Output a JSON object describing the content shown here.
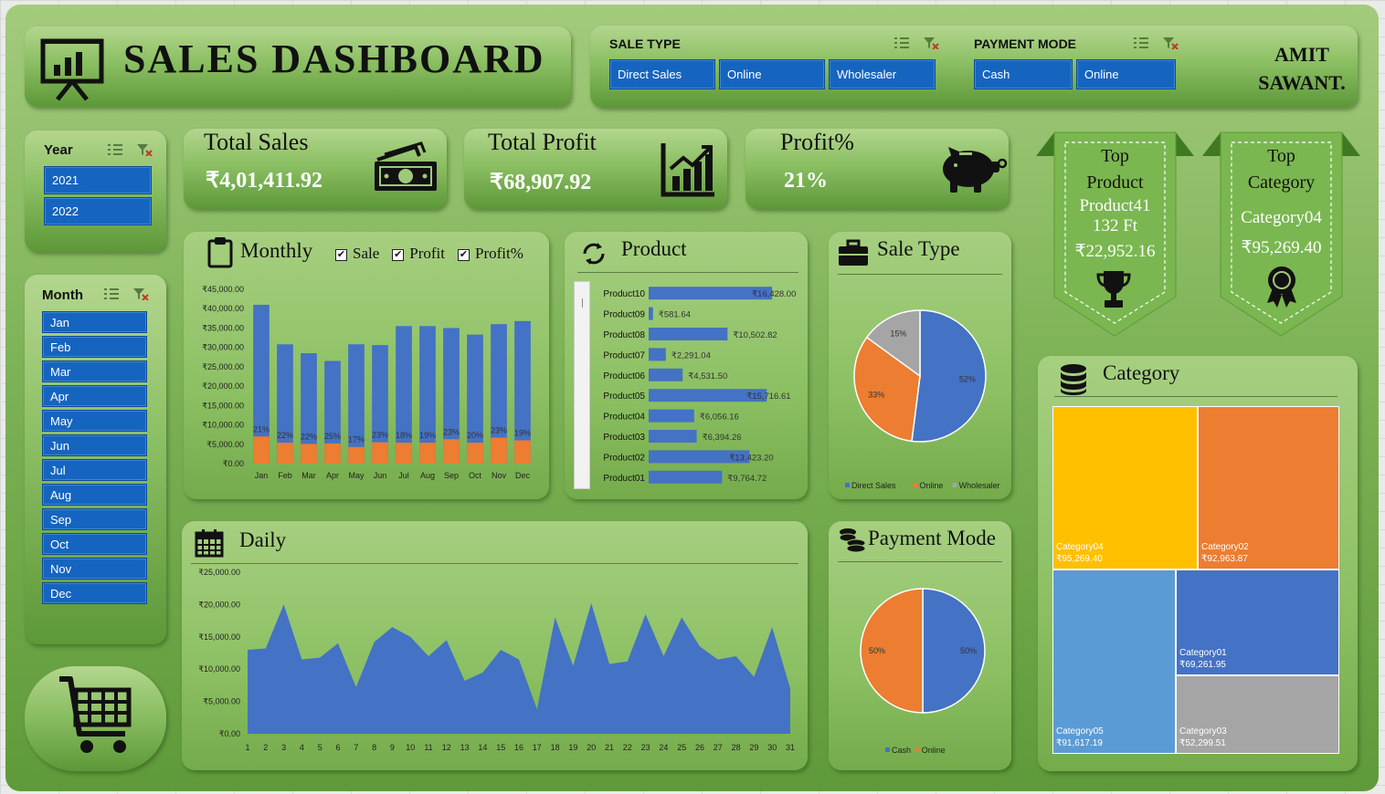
{
  "header": {
    "title": "SALES DASHBOARD",
    "author_line1": "AMIT",
    "author_line2": "SAWANT."
  },
  "slicers": {
    "sale_type": {
      "title": "SALE TYPE",
      "items": [
        "Direct Sales",
        "Online",
        "Wholesaler"
      ]
    },
    "payment_mode": {
      "title": "PAYMENT MODE",
      "items": [
        "Cash",
        "Online"
      ]
    },
    "year": {
      "title": "Year",
      "items": [
        "2021",
        "2022"
      ]
    },
    "month": {
      "title": "Month",
      "items": [
        "Jan",
        "Feb",
        "Mar",
        "Apr",
        "May",
        "Jun",
        "Jul",
        "Aug",
        "Sep",
        "Oct",
        "Nov",
        "Dec"
      ]
    }
  },
  "kpis": {
    "total_sales": {
      "label": "Total Sales",
      "value": "₹4,01,411.92"
    },
    "total_profit": {
      "label": "Total Profit",
      "value": "₹68,907.92"
    },
    "profit_pct": {
      "label": "Profit%",
      "value": "21%"
    }
  },
  "top_product": {
    "line1": "Top",
    "line2": "Product",
    "name1": "Product41",
    "name2": "132  Ft",
    "value": "₹22,952.16"
  },
  "top_category": {
    "line1": "Top",
    "line2": "Category",
    "name": "Category04",
    "value": "₹95,269.40"
  },
  "monthly": {
    "title": "Monthly",
    "checks": [
      "Sale",
      "Profit",
      "Profit%"
    ]
  },
  "product": {
    "title": "Product"
  },
  "sale_type_panel": {
    "title": "Sale Type"
  },
  "daily": {
    "title": "Daily"
  },
  "payment_panel": {
    "title": "Payment Mode"
  },
  "category_panel": {
    "title": "Category"
  },
  "colors": {
    "blue": "#4472c4",
    "orange": "#ed7d31",
    "gray": "#a5a5a5",
    "gold": "#ffc000",
    "lightblue": "#5b9bd5",
    "slicer": "#1565c0"
  },
  "chart_data": [
    {
      "type": "bar",
      "id": "monthly",
      "categories": [
        "Jan",
        "Feb",
        "Mar",
        "Apr",
        "May",
        "Jun",
        "Jul",
        "Aug",
        "Sep",
        "Oct",
        "Nov",
        "Dec"
      ],
      "series": [
        {
          "name": "Sale",
          "values": [
            41000,
            30800,
            28500,
            26500,
            30800,
            30600,
            35500,
            35500,
            35000,
            33300,
            36000,
            36800
          ]
        },
        {
          "name": "Profit",
          "values": [
            7000,
            5400,
            5100,
            5200,
            4300,
            5500,
            5400,
            5400,
            6300,
            5400,
            6700,
            6000
          ]
        },
        {
          "name": "Profit%",
          "values": [
            "21%",
            "22%",
            "22%",
            "25%",
            "17%",
            "23%",
            "18%",
            "19%",
            "23%",
            "20%",
            "23%",
            "19%"
          ]
        }
      ],
      "yticks": [
        "₹0.00",
        "₹5,000.00",
        "₹10,000.00",
        "₹15,000.00",
        "₹20,000.00",
        "₹25,000.00",
        "₹30,000.00",
        "₹35,000.00",
        "₹40,000.00",
        "₹45,000.00"
      ],
      "ylim": [
        0,
        45000
      ]
    },
    {
      "type": "bar",
      "id": "product",
      "categories": [
        "Product10",
        "Product09",
        "Product08",
        "Product07",
        "Product06",
        "Product05",
        "Product04",
        "Product03",
        "Product02",
        "Product01"
      ],
      "values": [
        16428.0,
        581.64,
        10502.82,
        2291.04,
        4531.5,
        15716.61,
        6056.16,
        6394.26,
        13423.2,
        9764.72
      ],
      "labels": [
        "₹16,428.00",
        "₹581.64",
        "₹10,502.82",
        "₹2,291.04",
        "₹4,531.50",
        "₹15,716.61",
        "₹6,056.16",
        "₹6,394.26",
        "₹13,423.20",
        "₹9,764.72"
      ]
    },
    {
      "type": "pie",
      "id": "sale_type",
      "categories": [
        "Direct Sales",
        "Online",
        "Wholesaler"
      ],
      "values": [
        52,
        33,
        15
      ],
      "labels": [
        "52%",
        "33%",
        "15%"
      ]
    },
    {
      "type": "area",
      "id": "daily",
      "x": [
        1,
        2,
        3,
        4,
        5,
        6,
        7,
        8,
        9,
        10,
        11,
        12,
        13,
        14,
        15,
        16,
        17,
        18,
        19,
        20,
        21,
        22,
        23,
        24,
        25,
        26,
        27,
        28,
        29,
        30,
        31
      ],
      "values": [
        13000,
        13200,
        20000,
        11500,
        11800,
        14000,
        7200,
        14200,
        16500,
        15000,
        12000,
        14500,
        8200,
        9500,
        13000,
        11500,
        3800,
        18000,
        10500,
        20200,
        10800,
        11200,
        18500,
        12000,
        18000,
        13500,
        11500,
        12000,
        8800,
        16500,
        7000
      ],
      "yticks": [
        "₹0.00",
        "₹5,000.00",
        "₹10,000.00",
        "₹15,000.00",
        "₹20,000.00",
        "₹25,000.00"
      ],
      "ylim": [
        0,
        25000
      ]
    },
    {
      "type": "pie",
      "id": "payment",
      "categories": [
        "Cash",
        "Online"
      ],
      "values": [
        50,
        50
      ],
      "labels": [
        "50%",
        "50%"
      ]
    },
    {
      "type": "heatmap",
      "id": "category_treemap",
      "categories": [
        "Category04",
        "Category02",
        "Category01",
        "Category05",
        "Category03"
      ],
      "values": [
        95269.4,
        92963.87,
        69261.95,
        91617.19,
        52299.51
      ],
      "labels": [
        "₹95,269.40",
        "₹92,963.87",
        "₹69,261.95",
        "₹91,617.19",
        "₹52,299.51"
      ]
    }
  ]
}
